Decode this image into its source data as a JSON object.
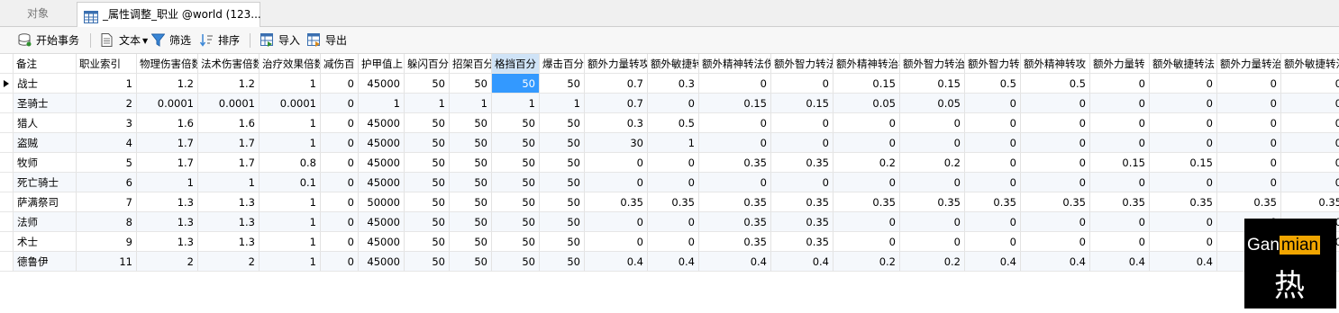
{
  "tabs": {
    "objects": "对象",
    "table": "_属性调整_职业 @world (123..."
  },
  "toolbar": {
    "begin_transaction": "开始事务",
    "text": "文本",
    "filter": "筛选",
    "sort": "排序",
    "import": "导入",
    "export": "导出"
  },
  "grid": {
    "columns": [
      "备注",
      "职业索引",
      "物理伤害倍数",
      "法术伤害倍数",
      "治疗效果倍数",
      "减伤百",
      "护甲值上",
      "躲闪百分",
      "招架百分",
      "格挡百分",
      "爆击百分",
      "额外力量转攻",
      "额外敏捷转",
      "额外精神转法伤",
      "额外智力转法",
      "额外精神转治疗",
      "额外智力转治",
      "额外智力转攻",
      "额外精神转攻",
      "额外力量转",
      "额外敏捷转法",
      "额外力量转治",
      "额外敏捷转治"
    ],
    "rows": [
      [
        "战士",
        "1",
        "1.2",
        "1.2",
        "1",
        "0",
        "45000",
        "50",
        "50",
        "50",
        "50",
        "0.7",
        "0.3",
        "0",
        "0",
        "0.15",
        "0.15",
        "0.5",
        "0.5",
        "0",
        "0",
        "0",
        "0"
      ],
      [
        "圣骑士",
        "2",
        "0.0001",
        "0.0001",
        "0.0001",
        "0",
        "1",
        "1",
        "1",
        "1",
        "1",
        "0.7",
        "0",
        "0.15",
        "0.15",
        "0.05",
        "0.05",
        "0",
        "0",
        "0",
        "0",
        "0",
        "0"
      ],
      [
        "猎人",
        "3",
        "1.6",
        "1.6",
        "1",
        "0",
        "45000",
        "50",
        "50",
        "50",
        "50",
        "0.3",
        "0.5",
        "0",
        "0",
        "0",
        "0",
        "0",
        "0",
        "0",
        "0",
        "0",
        "0"
      ],
      [
        "盗贼",
        "4",
        "1.7",
        "1.7",
        "1",
        "0",
        "45000",
        "50",
        "50",
        "50",
        "50",
        "30",
        "1",
        "0",
        "0",
        "0",
        "0",
        "0",
        "0",
        "0",
        "0",
        "0",
        "0"
      ],
      [
        "牧师",
        "5",
        "1.7",
        "1.7",
        "0.8",
        "0",
        "45000",
        "50",
        "50",
        "50",
        "50",
        "0",
        "0",
        "0.35",
        "0.35",
        "0.2",
        "0.2",
        "0",
        "0",
        "0.15",
        "0.15",
        "0",
        "0"
      ],
      [
        "死亡骑士",
        "6",
        "1",
        "1",
        "0.1",
        "0",
        "45000",
        "50",
        "50",
        "50",
        "50",
        "0",
        "0",
        "0",
        "0",
        "0",
        "0",
        "0",
        "0",
        "0",
        "0",
        "0",
        "0"
      ],
      [
        "萨满祭司",
        "7",
        "1.3",
        "1.3",
        "1",
        "0",
        "50000",
        "50",
        "50",
        "50",
        "50",
        "0.35",
        "0.35",
        "0.35",
        "0.35",
        "0.35",
        "0.35",
        "0.35",
        "0.35",
        "0.35",
        "0.35",
        "0.35",
        "0.35"
      ],
      [
        "法师",
        "8",
        "1.3",
        "1.3",
        "1",
        "0",
        "45000",
        "50",
        "50",
        "50",
        "50",
        "0",
        "0",
        "0.35",
        "0.35",
        "0",
        "0",
        "0",
        "0",
        "0",
        "0",
        "0",
        "0"
      ],
      [
        "术士",
        "9",
        "1.3",
        "1.3",
        "1",
        "0",
        "45000",
        "50",
        "50",
        "50",
        "50",
        "0",
        "0",
        "0.35",
        "0.35",
        "0",
        "0",
        "0",
        "0",
        "0",
        "0",
        "0",
        "0"
      ],
      [
        "德鲁伊",
        "11",
        "2",
        "2",
        "1",
        "0",
        "45000",
        "50",
        "50",
        "50",
        "50",
        "0.4",
        "0.4",
        "0.4",
        "0.4",
        "0.2",
        "0.2",
        "0.4",
        "0.4",
        "0.4",
        "0.4",
        "0",
        ""
      ]
    ]
  },
  "watermark": {
    "word_plain": "Gan",
    "word_highlight": "mian",
    "glyph": "热"
  },
  "colors": {
    "selection": "#3399ff",
    "watermark_accent": "#f0a500"
  }
}
